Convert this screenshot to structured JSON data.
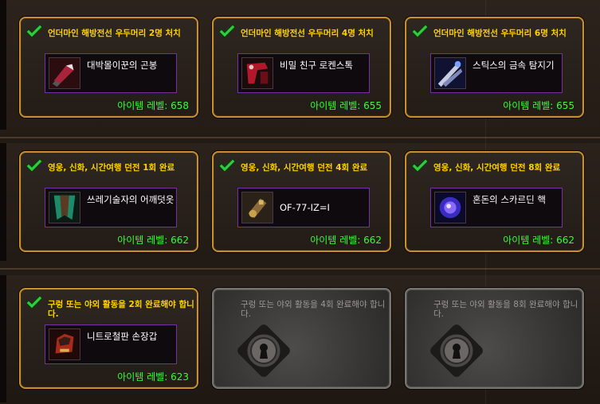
{
  "level_label": "아이템 레벨:",
  "colors": {
    "gold_border": "#c8902c",
    "title_yellow": "#ffd200",
    "level_green": "#33ff33",
    "item_border_epic": "#7a2fa0",
    "locked_text": "#9b9894"
  },
  "rows": [
    {
      "cards": [
        {
          "title": "언더마인 해방전선 우두머리 2명 처치",
          "completed": true,
          "item_name": "대박몰이꾼의 곤봉",
          "item_icon": "club-weapon-icon",
          "item_level": "658"
        },
        {
          "title": "언더마인 해방전선 우두머리 4명 처치",
          "completed": true,
          "item_name": "비밀 친구 로켄스톡",
          "item_icon": "red-gun-icon",
          "item_level": "655"
        },
        {
          "title": "언더마인 해방전선 우두머리 6명 처치",
          "completed": true,
          "item_name": "스틱스의 금속 탐지기",
          "item_icon": "metal-detector-icon",
          "item_level": "655"
        }
      ]
    },
    {
      "cards": [
        {
          "title": "영웅, 신화, 시간여행 던전 1회 완료",
          "completed": true,
          "item_name": "쓰레기술자의 어깨덧옷",
          "item_icon": "cloak-icon",
          "item_level": "662"
        },
        {
          "title": "영웅, 신화, 시간여행 던전 4회 완료",
          "completed": true,
          "item_name": "OF-77-IZ=I",
          "item_icon": "gadget-icon",
          "item_level": "662"
        },
        {
          "title": "영웅, 신화, 시간여행 던전 8회 완료",
          "completed": true,
          "item_name": "혼돈의 스카르딘 핵",
          "item_icon": "void-orb-icon",
          "item_level": "662"
        }
      ]
    },
    {
      "cards": [
        {
          "title": "구렁 또는 야외 활동을 2회 완료해야 합니다.",
          "completed": true,
          "item_name": "니트로철판 손장갑",
          "item_icon": "gauntlet-icon",
          "item_level": "623"
        },
        {
          "title": "구렁 또는 야외 활동을 4회 완료해야 합니다.",
          "completed": false
        },
        {
          "title": "구렁 또는 야외 활동을 8회 완료해야 합니다.",
          "completed": false
        }
      ]
    }
  ]
}
